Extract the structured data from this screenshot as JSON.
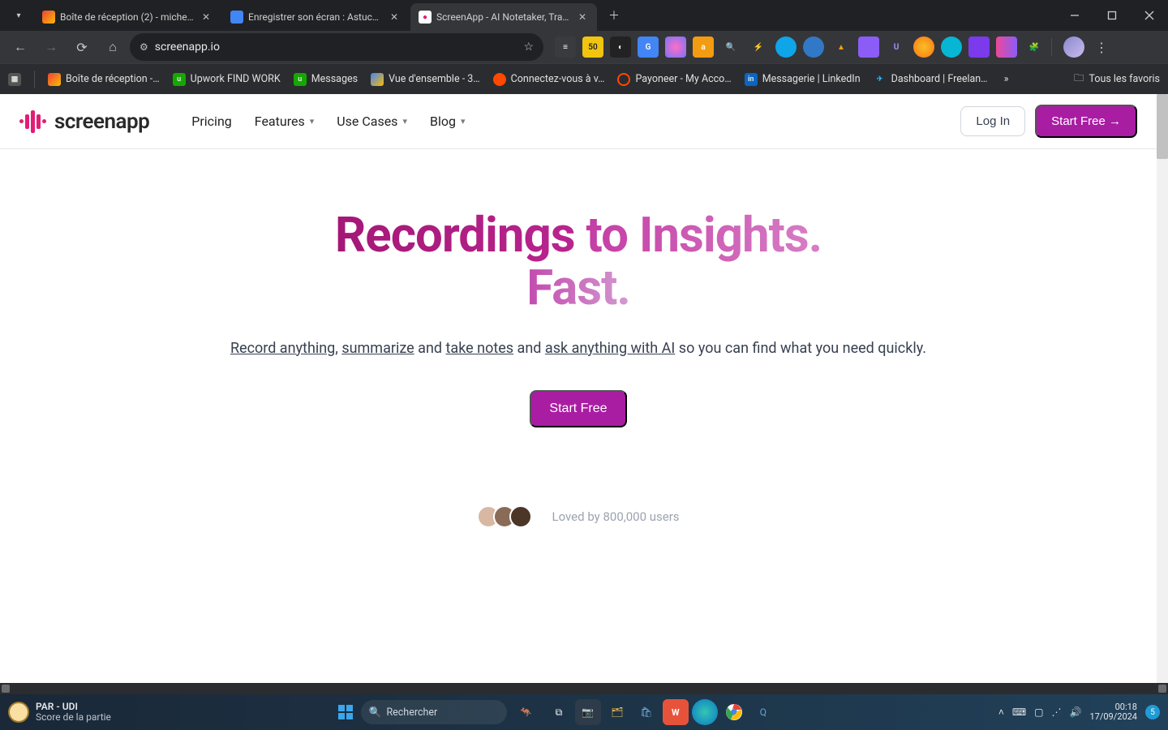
{
  "browser": {
    "tabs": [
      {
        "favicon": "gmail",
        "label": "Boîte de réception (2) - micheln"
      },
      {
        "favicon": "gdocs",
        "label": "Enregistrer son écran : Astuces,"
      },
      {
        "favicon": "screenapp",
        "label": "ScreenApp - AI Notetaker, Trans"
      }
    ],
    "address": "screenapp.io"
  },
  "bookmarks": [
    {
      "ico": "gmail",
      "label": "Boîte de réception -…"
    },
    {
      "ico": "upwork",
      "label": "Upwork FIND WORK"
    },
    {
      "ico": "upwork",
      "label": "Messages"
    },
    {
      "ico": "gads",
      "label": "Vue d'ensemble - 3…"
    },
    {
      "ico": "payoneer",
      "label": "Connectez-vous à v…"
    },
    {
      "ico": "payoneer2",
      "label": "Payoneer - My Acco…"
    },
    {
      "ico": "linkedin",
      "label": "Messagerie | LinkedIn"
    },
    {
      "ico": "freelancer",
      "label": "Dashboard | Freelan…"
    }
  ],
  "bookmarks_all": "Tous les favoris",
  "page": {
    "brand": "screenapp",
    "nav": {
      "pricing": "Pricing",
      "features": "Features",
      "usecases": "Use Cases",
      "blog": "Blog",
      "login": "Log In",
      "startfree": "Start Free →"
    },
    "hero": {
      "h1a": "Recordings",
      "h1b": " to Insights.",
      "h1c": "Fast.",
      "sub_record": "Record anything",
      "sub_summarize": "summarize",
      "sub_and1": " and ",
      "sub_takenotes": "take notes",
      "sub_and2": " and ",
      "sub_askai": "ask anything with AI",
      "sub_tail": " so you can find what you need quickly.",
      "cta": "Start Free",
      "loved": "Loved by 800,000 users"
    }
  },
  "taskbar": {
    "weather_title": "PAR - UDI",
    "weather_sub": "Score de la partie",
    "search_placeholder": "Rechercher",
    "time": "00:18",
    "date": "17/09/2024",
    "notif_count": "5"
  }
}
